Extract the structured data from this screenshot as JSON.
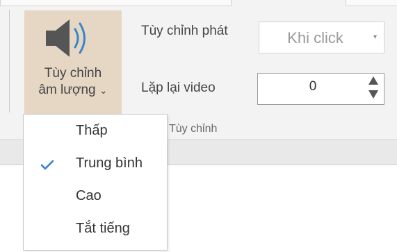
{
  "volume": {
    "label_line1": "Tùy chỉnh",
    "label_line2": "âm lượng",
    "dropdown_glyph": "⌄",
    "icon": "speaker-volume-icon",
    "highlight_color": "#e5d7c4"
  },
  "playback": {
    "label": "Tùy chỉnh phát",
    "selected_value": "Khi click",
    "arrow_glyph": "▾"
  },
  "loop": {
    "label": "Lặp lại video",
    "value": "0"
  },
  "group": {
    "label": "Tùy chỉnh"
  },
  "volume_menu": {
    "items": [
      {
        "label": "Thấp",
        "checked": false
      },
      {
        "label": "Trung bình",
        "checked": true
      },
      {
        "label": "Cao",
        "checked": false
      },
      {
        "label": "Tắt tiếng",
        "checked": false
      }
    ],
    "check_icon": "check-icon",
    "check_color": "#2e7cd6"
  }
}
